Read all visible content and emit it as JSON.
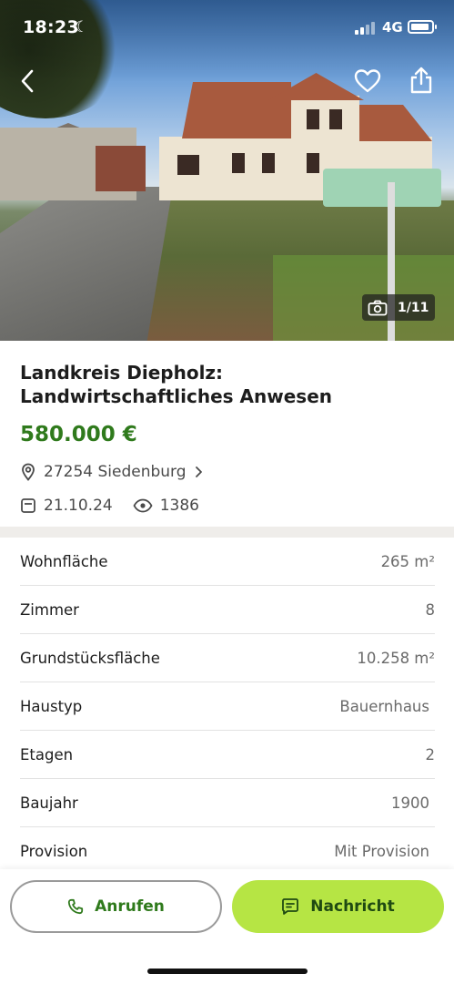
{
  "status_bar": {
    "time": "18:23",
    "network": "4G"
  },
  "gallery": {
    "counter": "1/11"
  },
  "listing": {
    "title": "Landkreis Diepholz: Landwirtschaftliches Anwesen",
    "price": "580.000 €",
    "location": "27254 Siedenburg",
    "date": "21.10.24",
    "views": "1386"
  },
  "details": [
    {
      "label": "Wohnfläche",
      "value": "265 m²"
    },
    {
      "label": "Zimmer",
      "value": "8"
    },
    {
      "label": "Grundstücksfläche",
      "value": "10.258 m²"
    },
    {
      "label": "Haustyp",
      "value": "Bauernhaus"
    },
    {
      "label": "Etagen",
      "value": "2"
    },
    {
      "label": "Baujahr",
      "value": "1900"
    },
    {
      "label": "Provision",
      "value": "Mit Provision"
    }
  ],
  "actions": {
    "call_label": "Anrufen",
    "message_label": "Nachricht"
  },
  "colors": {
    "price": "#2f7a1c",
    "primary_button": "#b6e544",
    "divider": "#efedea"
  },
  "icons": [
    "moon-icon",
    "back-icon",
    "heart-icon",
    "share-icon",
    "camera-icon",
    "location-pin-icon",
    "chevron-right-icon",
    "calendar-icon",
    "eye-icon",
    "phone-icon",
    "message-icon"
  ]
}
